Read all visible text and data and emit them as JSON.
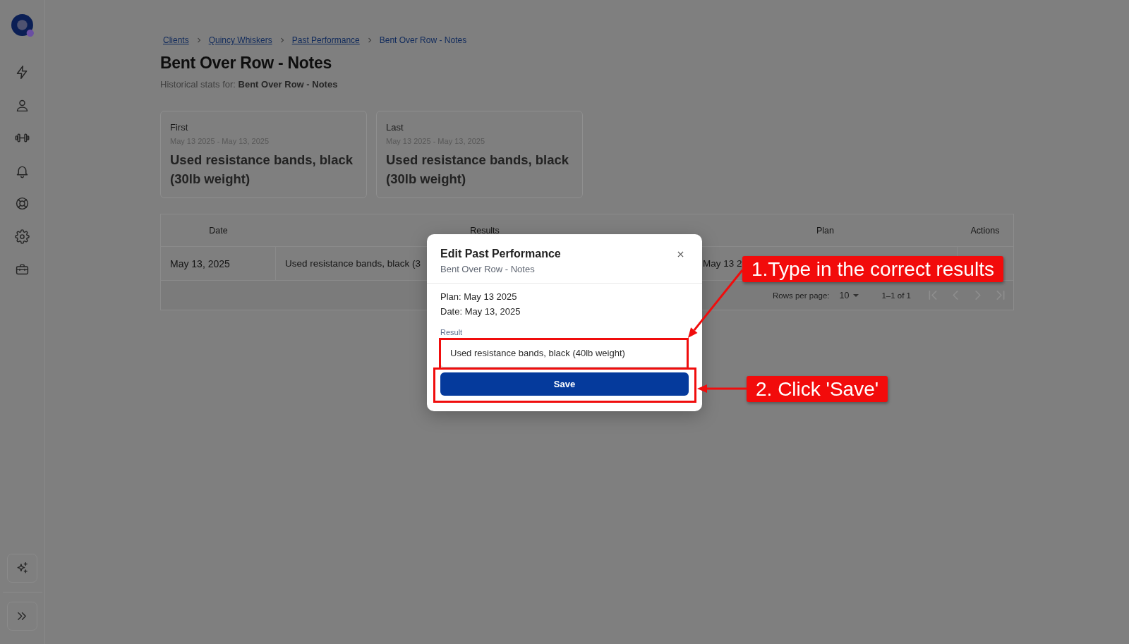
{
  "breadcrumbs": [
    {
      "label": "Clients",
      "current": false
    },
    {
      "label": "Quincy Whiskers",
      "current": false
    },
    {
      "label": "Past Performance",
      "current": false
    },
    {
      "label": "Bent Over Row - Notes",
      "current": true
    }
  ],
  "page": {
    "title": "Bent Over Row - Notes",
    "subtitle": "Historical stats for: **Bent Over Row - Notes**"
  },
  "cards": [
    {
      "label": "First",
      "date_range": "May 13 2025 - May 13, 2025",
      "value": "Used resistance bands, black (30lb weight)"
    },
    {
      "label": "Last",
      "date_range": "May 13 2025 - May 13, 2025",
      "value": "Used resistance bands, black (30lb weight)"
    }
  ],
  "table": {
    "columns": [
      "Date",
      "Results",
      "Plan",
      "Actions"
    ],
    "rows": [
      {
        "date": "May 13, 2025",
        "results": "Used resistance bands, black (3",
        "plan": "May 13 2"
      }
    ]
  },
  "footer": {
    "rows_per_page_label": "Rows per page:",
    "rows_per_page": "10",
    "range": "1–1 of 1",
    "pagination": [
      {
        "kind": "first",
        "disabled": true
      },
      {
        "kind": "previous",
        "disabled": true
      },
      {
        "kind": "next",
        "disabled": true
      },
      {
        "kind": "last",
        "disabled": true
      }
    ]
  },
  "dialog": {
    "title": "Edit Past Performance",
    "subtitle": "Bent Over Row - Notes",
    "details": [
      "Plan: May 13 2025",
      "Date: May 13, 2025"
    ],
    "field": {
      "label": "Result",
      "value": "Used resistance bands, black (40lb weight)"
    },
    "button": "Save"
  },
  "annotations": [
    {
      "kind": "to-field",
      "text": "1.Type in the correct results"
    },
    {
      "kind": "to-button",
      "text": "2. Click 'Save'"
    }
  ]
}
